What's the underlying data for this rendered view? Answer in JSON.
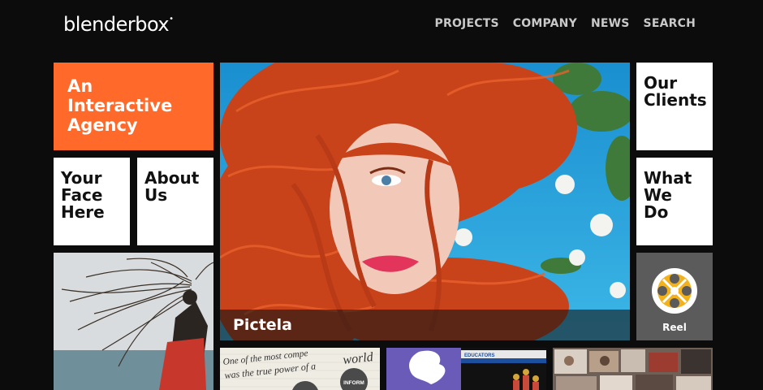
{
  "header": {
    "logo_text": "blenderbox",
    "logo_mark": "•",
    "nav": [
      "PROJECTS",
      "COMPANY",
      "NEWS",
      "SEARCH"
    ]
  },
  "tiles": {
    "agency": "An\nInteractive\nAgency",
    "your_face": "Your\nFace\nHere",
    "about": "About\nUs",
    "clients": "Our\nClients",
    "what_we_do": "What\nWe\nDo",
    "reel": "Reel"
  },
  "hero": {
    "caption": "Pictela"
  },
  "thumbs": {
    "quote_line1": "One of the most compe",
    "quote_line2": "was the true power of a",
    "quote_word": "world",
    "inform_label": "INFORM",
    "educators_label": "EDUCATORS"
  },
  "colors": {
    "background": "#0c0c0c",
    "accent": "#ff6a2a",
    "reel_bg": "#5b5b5b",
    "hair": "#c8421a",
    "sky": "#27a3dc"
  }
}
